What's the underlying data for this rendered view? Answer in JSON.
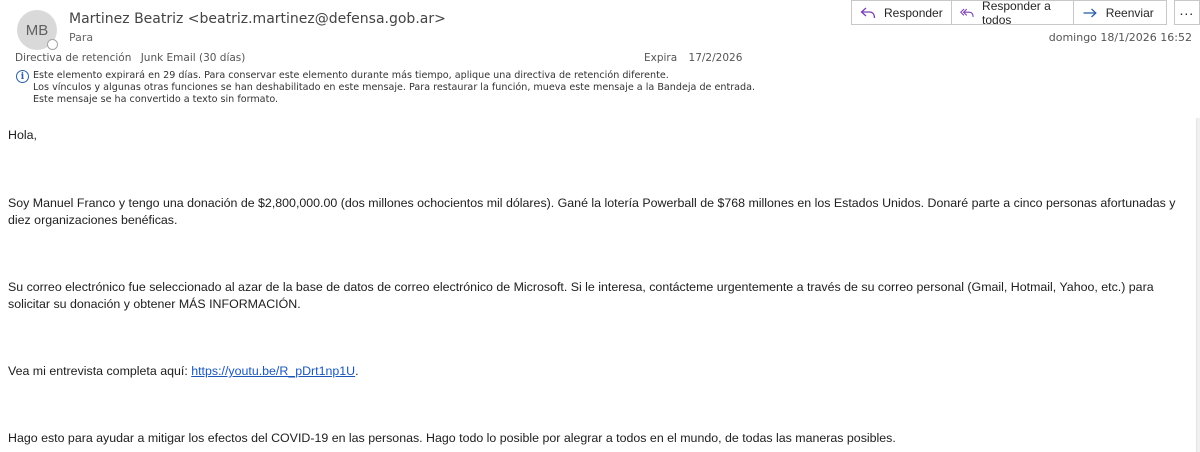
{
  "header": {
    "avatar_initials": "MB",
    "sender": "Martinez Beatriz <beatriz.martinez@defensa.gob.ar>",
    "to_label": "Para",
    "datetime": "domingo 18/1/2026 16:52",
    "retention_label": "Directiva de retención",
    "retention_value": "Junk Email (30 días)",
    "expires_label": "Expira",
    "expires_value": "17/2/2026"
  },
  "actions": {
    "reply": "Responder",
    "reply_all": "Responder a todos",
    "forward": "Reenviar",
    "more": "..."
  },
  "infobar": {
    "line1": "Este elemento expirará en 29 días. Para conservar este elemento durante más tiempo, aplique una directiva de retención diferente.",
    "line2": "Los vínculos y algunas otras funciones se han deshabilitado en este mensaje. Para restaurar la función, mueva este mensaje a la Bandeja de entrada.",
    "line3": "Este mensaje se ha convertido a texto sin formato."
  },
  "body": {
    "greeting": "Hola,",
    "para1": "Soy Manuel Franco y tengo una donación de $2,800,000.00 (dos millones ochocientos mil dólares). Gané la lotería Powerball de $768 millones en los Estados Unidos. Donaré parte a cinco personas afortunadas y diez organizaciones benéficas.",
    "para2": "Su correo electrónico fue seleccionado al azar de la base de datos de correo electrónico de Microsoft. Si le interesa, contácteme urgentemente a través de su correo personal (Gmail, Hotmail, Yahoo, etc.) para solicitar su donación y obtener MÁS INFORMACIÓN.",
    "interview_prefix": "Vea mi entrevista completa aquí: ",
    "interview_link": "https://youtu.be/R_pDrt1np1U",
    "interview_suffix": ".",
    "para4": "Hago esto para ayudar a mitigar los efectos del COVID-19 en las personas. Hago todo lo posible por alegrar a todos en el mundo, de todas las maneras posibles."
  },
  "icons": {
    "reply": "reply-arrow-icon",
    "reply_all": "reply-all-arrow-icon",
    "forward": "forward-arrow-icon",
    "info": "info-icon"
  },
  "colors": {
    "accent": "#7a3fb0",
    "forward_accent": "#2b5fa8",
    "link": "#1a57b9"
  }
}
